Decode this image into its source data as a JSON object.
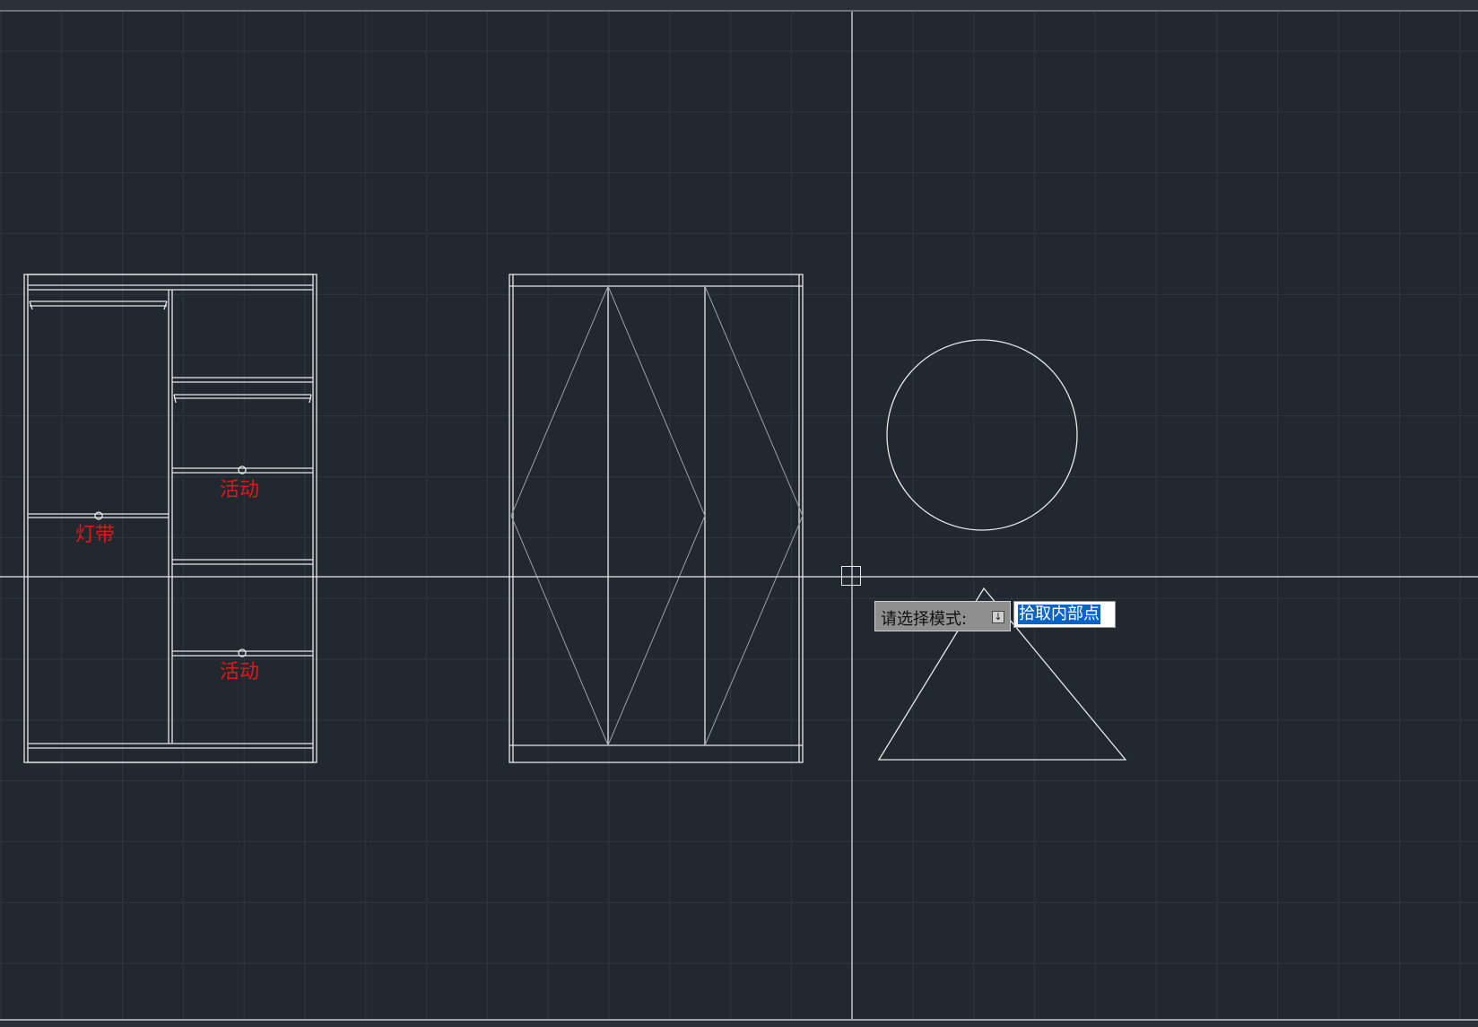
{
  "canvas": {
    "background": "#212830",
    "grid_color": "#2f3743",
    "line_color": "#e8e8e8",
    "annotation_color": "#e01818"
  },
  "annotations": {
    "light_strip": "灯带",
    "movable_upper": "活动",
    "movable_lower": "活动"
  },
  "command_prompt": {
    "label": "请选择模式:",
    "dropdown_icon": "down-arrow-icon",
    "input_value": "拾取内部点"
  },
  "cursor": {
    "icon": "crosshair-pickbox-icon"
  }
}
